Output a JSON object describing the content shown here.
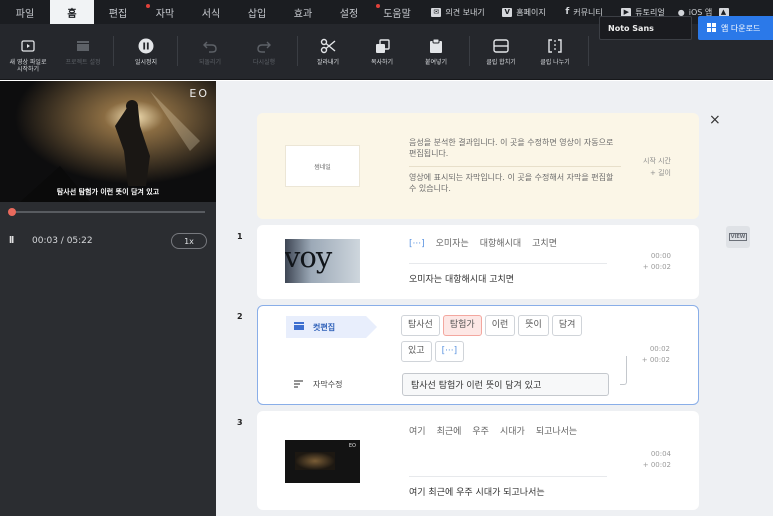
{
  "menubar": {
    "items": [
      {
        "label": "파일",
        "active": false,
        "dot": false
      },
      {
        "label": "홈",
        "active": true,
        "dot": false
      },
      {
        "label": "편집",
        "active": false,
        "dot": false
      },
      {
        "label": "자막",
        "active": false,
        "dot": true
      },
      {
        "label": "서식",
        "active": false,
        "dot": false
      },
      {
        "label": "삽입",
        "active": false,
        "dot": false
      },
      {
        "label": "효과",
        "active": false,
        "dot": false
      },
      {
        "label": "설정",
        "active": false,
        "dot": false
      },
      {
        "label": "도움말",
        "active": false,
        "dot": true
      }
    ],
    "links": [
      {
        "icon": "mail-icon",
        "label": "의견 보내기"
      },
      {
        "icon": "homepage-icon",
        "label": "홈페이지"
      },
      {
        "icon": "facebook-icon",
        "label": "커뮤니티"
      },
      {
        "icon": "youtube-icon",
        "label": "튜토리얼"
      },
      {
        "icon": "apple-icon",
        "label": "iOS 앱"
      }
    ]
  },
  "toolbar": {
    "new_project": "새 영상 파일로 시작하기",
    "project_settings": "프로젝트 설정",
    "pause": "일시정지",
    "undo": "되돌리기",
    "redo": "다시실행",
    "cut": "잘라내기",
    "copy": "복사하기",
    "paste": "붙여넣기",
    "clip_merge": "클립 합치기",
    "clip_split": "클립 나누기",
    "font": "Noto Sans",
    "app_download": "앱 다운로드"
  },
  "player": {
    "logo": "EO",
    "caption": "탐사선 탐험가 이런 뜻이 담겨 있고",
    "pause_icon": "ll",
    "time": "00:03 / 05:22",
    "speed": "1x",
    "progress_fraction": 0.01
  },
  "help": {
    "thumbnail": "썸네일",
    "text1": "음성을 분석한 결과입니다. 이 곳을 수정하면 영상이 자동으로 편집됩니다.",
    "text2": "영상에 표시되는 자막입니다. 이 곳을 수정해서 자막을 편집할 수 있습니다.",
    "start_time": "시작 시간",
    "length": "+ 길이",
    "close": "×"
  },
  "view_toggle": "VIEW",
  "clips": [
    {
      "number": "1",
      "thumb_text": "voy",
      "words": [
        "[···]",
        "오미자는",
        "대항해시대",
        "고치면"
      ],
      "subtitle": "오미자는 대항해시대 고치면",
      "start": "00:00",
      "duration": "+ 00:02"
    },
    {
      "number": "2",
      "cut_edit": "컷편집",
      "chips": [
        "탐사선",
        "탐험가",
        "이런",
        "뜻이",
        "담겨",
        "있고",
        "[···]"
      ],
      "subtitle_edit": "자막수정",
      "subtitle": "탐사선 탐험가 이런 뜻이 담겨 있고",
      "start": "00:02",
      "duration": "+ 00:02"
    },
    {
      "number": "3",
      "thumb_logo": "EO",
      "words": [
        "여기",
        "최근에",
        "우주",
        "시대가",
        "되고나서는"
      ],
      "subtitle": "여기 최근에 우주 시대가 되고나서는",
      "start": "00:04",
      "duration": "+ 00:02"
    }
  ]
}
